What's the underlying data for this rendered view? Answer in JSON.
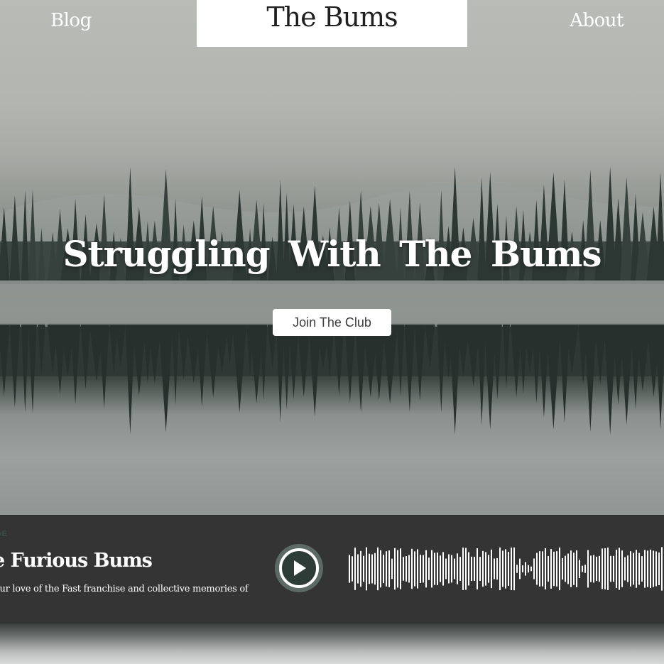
{
  "nav": {
    "left_link": "Blog",
    "right_link": "About",
    "logo": "The Bums"
  },
  "hero": {
    "title": "Struggling With The Bums",
    "cta_label": "Join The Club"
  },
  "player": {
    "episode_label": "ODE",
    "episode_title": "e Furious Bums",
    "episode_description": "our love of the Fast franchise and collective memories of",
    "play_icon": "play-icon",
    "accent_color": "#2d3c36"
  },
  "colors": {
    "player_bg": "#343434",
    "logo_bg": "#ffffff"
  }
}
